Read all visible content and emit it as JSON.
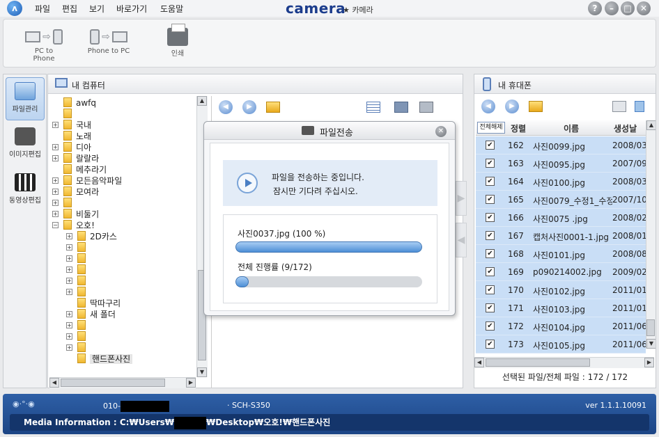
{
  "app": {
    "brand": "camera",
    "brand_sub": "★ 카메라",
    "logo_glyph": "ʌ",
    "menu": [
      "파일",
      "편집",
      "보기",
      "바로가기",
      "도움말"
    ],
    "window_buttons": [
      "?",
      "–",
      "□",
      "✕"
    ]
  },
  "toolbar": {
    "pc_to_phone": "PC to Phone",
    "phone_to_pc": "Phone to PC",
    "print": "인쇄"
  },
  "side_tabs": [
    {
      "label": "파일관리",
      "active": true
    },
    {
      "label": "이미지편집",
      "active": false
    },
    {
      "label": "동영상편집",
      "active": false
    }
  ],
  "pc_panel": {
    "title": "내 컴퓨터",
    "tree": [
      {
        "label": "awfq",
        "expander": false,
        "indent": 0
      },
      {
        "label": "",
        "expander": false,
        "indent": 0
      },
      {
        "label": "국내",
        "expander": true,
        "indent": 0
      },
      {
        "label": "노래",
        "expander": false,
        "indent": 0
      },
      {
        "label": "디아",
        "expander": true,
        "indent": 0
      },
      {
        "label": "랄랄라",
        "expander": true,
        "indent": 0
      },
      {
        "label": "메추라기",
        "expander": false,
        "indent": 0
      },
      {
        "label": "모든음악파일",
        "expander": true,
        "indent": 0
      },
      {
        "label": "모여라",
        "expander": true,
        "indent": 0
      },
      {
        "label": "",
        "expander": true,
        "indent": 0
      },
      {
        "label": "비둘기",
        "expander": true,
        "indent": 0
      },
      {
        "label": "오호!",
        "expander": true,
        "indent": 0
      },
      {
        "label": "2D카스",
        "expander": true,
        "indent": 1
      },
      {
        "label": "",
        "expander": true,
        "indent": 1
      },
      {
        "label": "",
        "expander": true,
        "indent": 1
      },
      {
        "label": "",
        "expander": true,
        "indent": 1
      },
      {
        "label": "",
        "expander": true,
        "indent": 1
      },
      {
        "label": "",
        "expander": true,
        "indent": 1
      },
      {
        "label": "딱따구리",
        "expander": false,
        "indent": 1
      },
      {
        "label": "새 폴더",
        "expander": true,
        "indent": 1
      },
      {
        "label": "",
        "expander": true,
        "indent": 1
      },
      {
        "label": "",
        "expander": true,
        "indent": 1
      },
      {
        "label": "",
        "expander": true,
        "indent": 1
      },
      {
        "label": "핸드폰사진",
        "expander": false,
        "indent": 1
      }
    ]
  },
  "dialog": {
    "title": "파일전송",
    "close": "✕",
    "message_line1": "파일을 전송하는 중입니다.",
    "message_line2": "잠시만 기다려 주십시오.",
    "file_progress_label": "사진0037.jpg  (100 %)",
    "file_progress": 1.0,
    "total_progress_label": "전체 진행률   (9/172)",
    "total_progress": 0.052
  },
  "phone_panel": {
    "title": "내 휴대폰",
    "columns": {
      "deselect_all": "전체해제",
      "sort": "정렬",
      "name": "이름",
      "created": "생성날"
    },
    "rows": [
      {
        "num": "162",
        "name": "사진0099.jpg",
        "date": "2008/03/",
        "checked": true
      },
      {
        "num": "163",
        "name": "사진0095.jpg",
        "date": "2007/09/",
        "checked": true
      },
      {
        "num": "164",
        "name": "사진0100.jpg",
        "date": "2008/03/",
        "checked": true
      },
      {
        "num": "165",
        "name": "사진0079_수정1_수정",
        "date": "2007/10/",
        "checked": true
      },
      {
        "num": "166",
        "name": "사진0075 .jpg",
        "date": "2008/02/",
        "checked": true
      },
      {
        "num": "167",
        "name": "캡처사진0001-1.jpg",
        "date": "2008/01/",
        "checked": true
      },
      {
        "num": "168",
        "name": "사진0101.jpg",
        "date": "2008/08/",
        "checked": true
      },
      {
        "num": "169",
        "name": "p090214002.jpg",
        "date": "2009/02/",
        "checked": true
      },
      {
        "num": "170",
        "name": "사진0102.jpg",
        "date": "2011/01/",
        "checked": true
      },
      {
        "num": "171",
        "name": "사진0103.jpg",
        "date": "2011/01/",
        "checked": true
      },
      {
        "num": "172",
        "name": "사진0104.jpg",
        "date": "2011/06/",
        "checked": true
      },
      {
        "num": "173",
        "name": "사진0105.jpg",
        "date": "2011/06/",
        "checked": true
      }
    ],
    "status": "선택된 파일/전체 파일 : 172 / 172"
  },
  "statusbar": {
    "phone_prefix": "010-",
    "model": "SCH-S350",
    "version": "ver 1.1.1.10091",
    "media_label": "Media Information :",
    "path_prefix": "C:₩Users₩",
    "path_suffix": "₩Desktop₩오호!₩핸드폰사진"
  }
}
